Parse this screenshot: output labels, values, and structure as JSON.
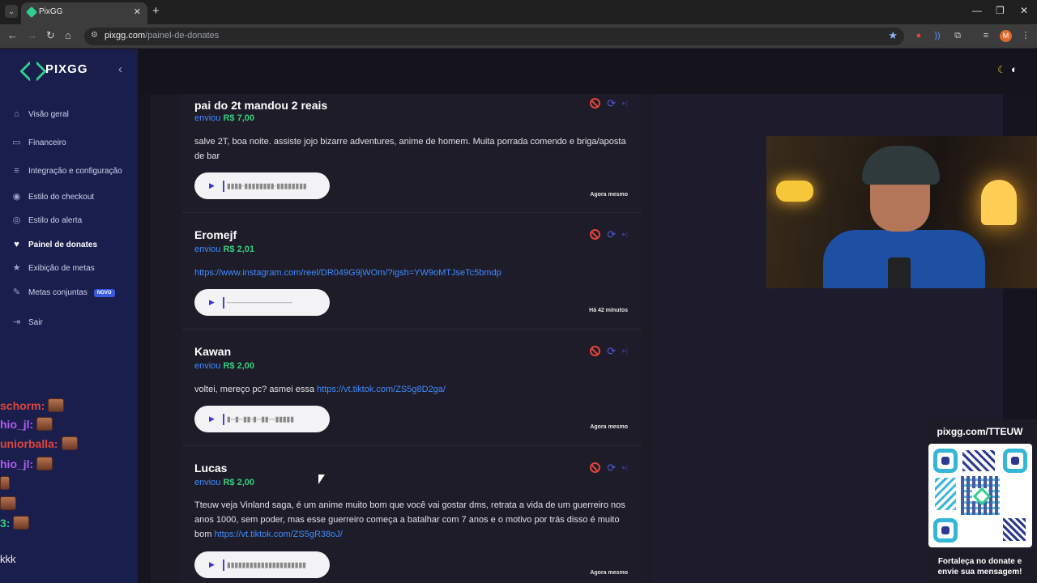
{
  "browser": {
    "tab_title": "PixGG",
    "url_host": "pixgg.com",
    "url_path": "/painel-de-donates",
    "profile_initial": "M"
  },
  "sidebar": {
    "logo": "PIXGG",
    "items": [
      {
        "label": "Visão geral",
        "icon": "home-icon"
      },
      {
        "label": "Financeiro",
        "icon": "wallet-icon"
      },
      {
        "label": "Integração e configuração",
        "icon": "integration-icon"
      },
      {
        "label": "Estilo do checkout",
        "icon": "palette-icon"
      },
      {
        "label": "Estilo do alerta",
        "icon": "palette-icon"
      },
      {
        "label": "Painel de donates",
        "icon": "donate-icon",
        "active": true
      },
      {
        "label": "Exibição de metas",
        "icon": "star-icon"
      },
      {
        "label": "Metas conjuntas",
        "icon": "target-icon",
        "badge": "NOVO"
      },
      {
        "label": "Sair",
        "icon": "logout-icon"
      }
    ]
  },
  "chat": {
    "lines": [
      {
        "name": "schorm:",
        "color": "#e0453a"
      },
      {
        "name": "hio_jl:",
        "color": "#b15cf0"
      },
      {
        "name": "uniorballa:",
        "color": "#e0453a"
      },
      {
        "name": "hio_jl:",
        "color": "#b15cf0"
      },
      {
        "name": "",
        "color": "#e0453a"
      },
      {
        "name": "",
        "color": "#e0453a"
      },
      {
        "name": "3:",
        "color": "#35d07f"
      }
    ],
    "last_message": "kkk"
  },
  "donations": [
    {
      "name": "pai do 2t mandou 2 reais",
      "sent_label": "enviou",
      "amount": "R$ 7,00",
      "message_text": "salve 2T, boa noite. assiste jojo bizarre adventures, anime de homem. Muita porrada comendo e briga/aposta de bar",
      "message_link": "",
      "waveform": "▮▮▮▮-▮▮▮▮▮▮▮▮-▮▮▮▮▮▮▮▮",
      "time": "Agora mesmo"
    },
    {
      "name": "Eromejf",
      "sent_label": "enviou",
      "amount": "R$ 2,01",
      "message_text": "",
      "message_link": "https://www.instagram.com/reel/DR049G9jWOm/?igsh=YW9oMTJseTc5bmdp",
      "waveform": "------------------------------",
      "time": "Há 42 minutos"
    },
    {
      "name": "Kawan",
      "sent_label": "enviou",
      "amount": "R$ 2,00",
      "message_text": "voltei, mereço pc? asmei essa ",
      "message_link": "https://vt.tiktok.com/ZS5g8D2ga/",
      "waveform": "▮--▮--▮▮-▮--▮▮---▮▮▮▮▮",
      "time": "Agora mesmo"
    },
    {
      "name": "Lucas",
      "sent_label": "enviou",
      "amount": "R$ 2,00",
      "message_text": "Tteuw veja Vinland saga, é um anime muito bom que você vai gostar dms, retrata a vida de um guerreiro nos anos 1000, sem poder, mas esse guerreiro começa a batalhar com 7 anos e o motivo por trás disso é muito bom ",
      "message_link": "https://vt.tiktok.com/ZS5gR38oJ/",
      "waveform": "▮▮▮▮▮▮▮▮▮▮▮▮▮▮▮▮▮▮▮▮▮",
      "time": "Agora mesmo"
    }
  ],
  "qr_widget": {
    "title": "pixgg.com/TTEUW",
    "caption_line1": "Fortaleça no donate e",
    "caption_line2": "envie sua mensagem!"
  },
  "colors": {
    "sidebar_bg": "#1a1e4d",
    "accent_green": "#35d07f",
    "link_blue": "#3f8cff"
  }
}
